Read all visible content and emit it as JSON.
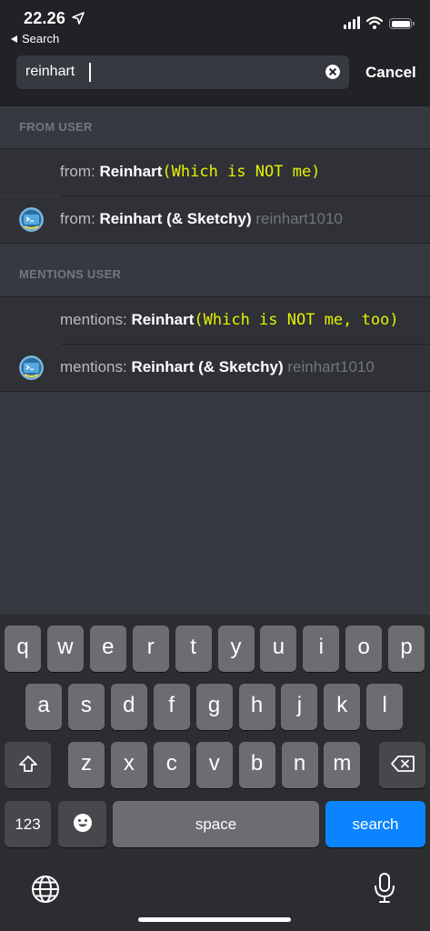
{
  "status_bar": {
    "time": "22.26",
    "back_app_label": "Search",
    "location_icon": "location-arrow-icon",
    "signal_icon": "cellular-signal-icon",
    "wifi_icon": "wifi-icon",
    "battery_icon": "battery-icon"
  },
  "search": {
    "value": "reinhart",
    "clear_icon": "clear-icon",
    "cancel_label": "Cancel"
  },
  "sections": [
    {
      "header": "FROM USER",
      "rows": [
        {
          "prefix": "from: ",
          "name": "Reinhart",
          "note": "(Which is NOT me)",
          "handle": "",
          "has_avatar": false
        },
        {
          "prefix": "from: ",
          "name": "Reinhart (& Sketchy)",
          "note": "",
          "handle": "reinhart1010",
          "has_avatar": true
        }
      ]
    },
    {
      "header": "MENTIONS USER",
      "rows": [
        {
          "prefix": "mentions: ",
          "name": "Reinhart",
          "note": "(Which is NOT me, too)",
          "handle": "",
          "has_avatar": false
        },
        {
          "prefix": "mentions: ",
          "name": "Reinhart (& Sketchy)",
          "note": "",
          "handle": "reinhart1010",
          "has_avatar": true
        }
      ]
    }
  ],
  "keyboard": {
    "row1": [
      "q",
      "w",
      "e",
      "r",
      "t",
      "y",
      "u",
      "i",
      "o",
      "p"
    ],
    "row2": [
      "a",
      "s",
      "d",
      "f",
      "g",
      "h",
      "j",
      "k",
      "l"
    ],
    "row3": [
      "z",
      "x",
      "c",
      "v",
      "b",
      "n",
      "m"
    ],
    "numbers_label": "123",
    "space_label": "space",
    "search_label": "search",
    "shift_icon": "shift-icon",
    "backspace_icon": "backspace-icon",
    "emoji_icon": "emoji-icon",
    "globe_icon": "globe-icon",
    "mic_icon": "microphone-icon"
  },
  "colors": {
    "background": "#36393f",
    "header_bg": "#202225",
    "highlight_text": "#e5f200",
    "search_key": "#0a84ff"
  }
}
